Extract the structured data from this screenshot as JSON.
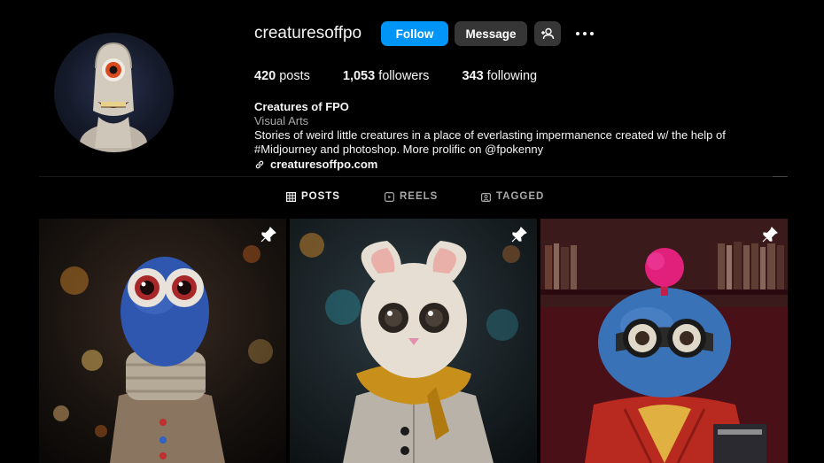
{
  "profile": {
    "username": "creaturesoffpo",
    "follow_label": "Follow",
    "message_label": "Message",
    "add_user_icon": "person-add-icon",
    "more_icon": "more-options-icon",
    "avatar_icon": "profile-avatar"
  },
  "stats": {
    "posts_count": "420",
    "posts_label": " posts",
    "followers_count": "1,053",
    "followers_label": " followers",
    "following_count": "343",
    "following_label": " following"
  },
  "bio": {
    "full_name": "Creatures of FPO",
    "category": "Visual Arts",
    "text": "Stories of weird little creatures in a place of everlasting impermanence created w/ the help of #Midjourney and photoshop. More prolific on @fpokenny",
    "link": "creaturesoffpo.com"
  },
  "tabs": [
    {
      "label": "POSTS",
      "icon": "grid-icon",
      "active": true
    },
    {
      "label": "REELS",
      "icon": "reels-icon",
      "active": false
    },
    {
      "label": "TAGGED",
      "icon": "tagged-icon",
      "active": false
    }
  ],
  "posts": [
    {
      "pinned": true,
      "icon": "pin-icon"
    },
    {
      "pinned": true,
      "icon": "pin-icon"
    },
    {
      "pinned": true,
      "icon": "pin-icon"
    }
  ],
  "colors": {
    "accent": "#0095f6",
    "button_secondary": "#363636",
    "background": "#000000",
    "muted_text": "#a8a8a8"
  }
}
